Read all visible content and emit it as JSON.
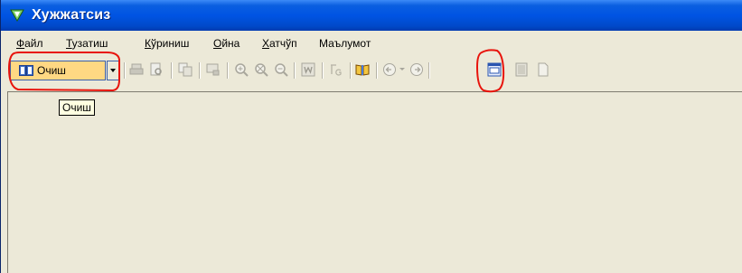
{
  "window": {
    "title": "Хужжатсиз"
  },
  "menu": [
    {
      "label": "Файл",
      "underline": "Ф",
      "rest": "айл"
    },
    {
      "label": "Тузатиш",
      "underline": "Т",
      "rest": "узатиш"
    },
    {
      "label": "Кўриниш",
      "underline": "К",
      "rest": "ўриниш"
    },
    {
      "label": "Ойна",
      "underline": "О",
      "rest": "йна"
    },
    {
      "label": "Хатчўп",
      "underline": "Х",
      "rest": "атчўп"
    },
    {
      "label": "Маълумот",
      "underline": "",
      "rest": "Маълумот"
    }
  ],
  "toolbar": {
    "open_label": "Очиш",
    "icons": [
      "print-icon",
      "print-preview-icon",
      "copy-icon",
      "find-icon",
      "zoom-in-icon",
      "zoom-fit-icon",
      "zoom-out-icon",
      "word-icon",
      "text-format-icon",
      "book-open-icon",
      "back-icon",
      "forward-icon",
      "window-icon",
      "page-icon",
      "doc-icon"
    ]
  },
  "tooltip": {
    "text": "Очиш"
  },
  "colors": {
    "title_bar": "#0054e3",
    "annotation": "#e8140c",
    "button_highlight": "#ffd883"
  }
}
